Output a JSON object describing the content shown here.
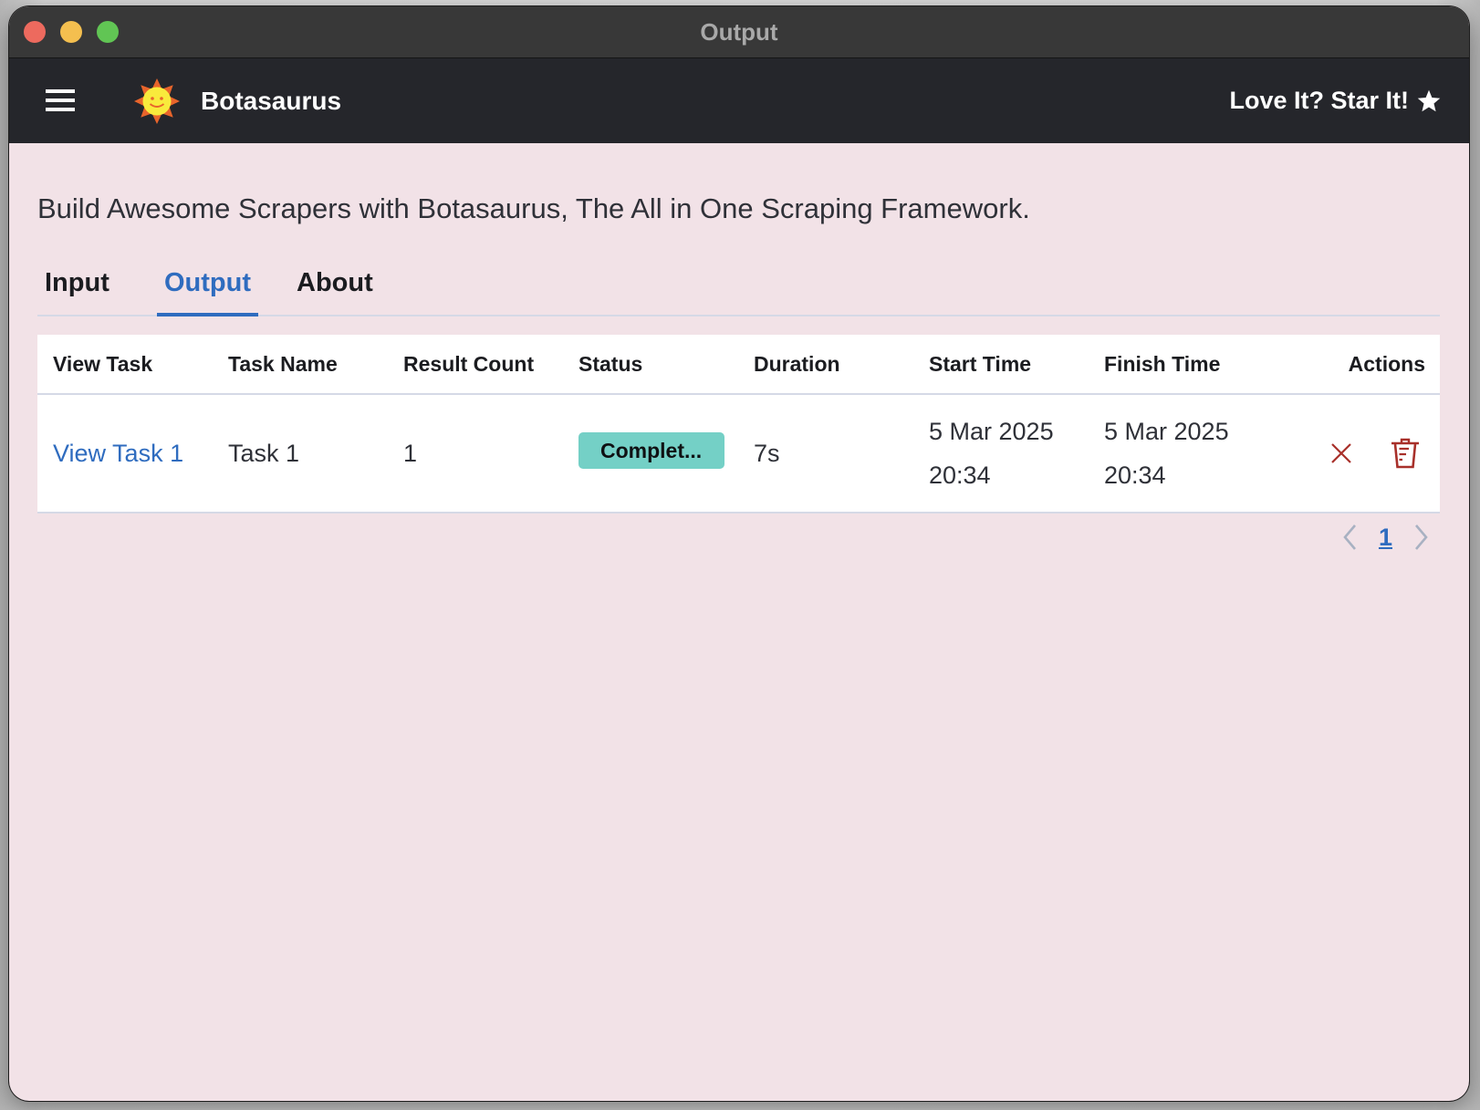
{
  "window": {
    "title": "Output"
  },
  "navbar": {
    "menu_icon": "hamburger-menu-icon",
    "logo_icon": "smiling-sun-logo",
    "brand": "Botasaurus",
    "star_link": "Love It? Star It!",
    "star_icon": "star-icon"
  },
  "page": {
    "subtitle": "Build Awesome Scrapers with Botasaurus, The All in One Scraping Framework."
  },
  "tabs": [
    {
      "label": "Input",
      "active": false
    },
    {
      "label": "Output",
      "active": true
    },
    {
      "label": "About",
      "active": false
    }
  ],
  "table": {
    "columns": [
      "View Task",
      "Task Name",
      "Result Count",
      "Status",
      "Duration",
      "Start Time",
      "Finish Time",
      "Actions"
    ],
    "rows": [
      {
        "view_task": "View Task 1",
        "task_name": "Task 1",
        "result_count": "1",
        "status": "Complet...",
        "duration": "7s",
        "start_date": "5 Mar 2025",
        "start_time": "20:34",
        "finish_date": "5 Mar 2025",
        "finish_time": "20:34",
        "actions": [
          "abort-icon",
          "delete-icon"
        ]
      }
    ]
  },
  "pagination": {
    "current_page": "1",
    "prev_icon": "chevron-left-icon",
    "next_icon": "chevron-right-icon"
  },
  "colors": {
    "accent": "#2f6cbf",
    "status_completed": "#74d0c6",
    "danger": "#a8302a",
    "navbar_bg": "#25262b",
    "page_bg": "#f2e2e7"
  }
}
